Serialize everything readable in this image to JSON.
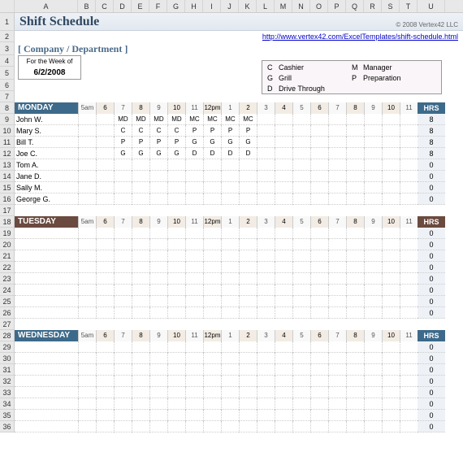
{
  "title": "Shift Schedule",
  "copyright": "© 2008 Vertex42 LLC",
  "link_text": "http://www.vertex42.com/ExcelTemplates/shift-schedule.html",
  "company_label": "[ Company / Department ]",
  "week_label": "For the Week of",
  "week_date": "6/2/2008",
  "legend": [
    {
      "code": "C",
      "name": "Cashier"
    },
    {
      "code": "G",
      "name": "Grill"
    },
    {
      "code": "D",
      "name": "Drive Through"
    },
    {
      "code": "M",
      "name": "Manager"
    },
    {
      "code": "P",
      "name": "Preparation"
    }
  ],
  "col_letters": [
    "A",
    "B",
    "C",
    "D",
    "E",
    "F",
    "G",
    "H",
    "I",
    "J",
    "K",
    "L",
    "M",
    "N",
    "O",
    "P",
    "Q",
    "R",
    "S",
    "T",
    "U"
  ],
  "row_numbers_visible": [
    1,
    2,
    3,
    4,
    5,
    6,
    7,
    8,
    9,
    10,
    11,
    12,
    13,
    14,
    15,
    16,
    17,
    18,
    19,
    20,
    21,
    22,
    23,
    24,
    25,
    26,
    27,
    28,
    29,
    30,
    31,
    32,
    33,
    34,
    35,
    36
  ],
  "time_headers": [
    "5am",
    "6",
    "7",
    "8",
    "9",
    "10",
    "11",
    "12pm",
    "1",
    "2",
    "3",
    "4",
    "5",
    "6",
    "7",
    "8",
    "9",
    "10",
    "11"
  ],
  "hrs_label": "HRS",
  "days": [
    {
      "name": "MONDAY",
      "class": "monday",
      "rows": [
        {
          "name": "John W.",
          "slots": [
            "",
            "",
            "MD",
            "MD",
            "MD",
            "MD",
            "MC",
            "MC",
            "MC",
            "MC",
            "",
            "",
            "",
            "",
            "",
            "",
            "",
            "",
            ""
          ],
          "hrs": "8"
        },
        {
          "name": "Mary S.",
          "slots": [
            "",
            "",
            "C",
            "C",
            "C",
            "C",
            "P",
            "P",
            "P",
            "P",
            "",
            "",
            "",
            "",
            "",
            "",
            "",
            "",
            ""
          ],
          "hrs": "8"
        },
        {
          "name": "Bill T.",
          "slots": [
            "",
            "",
            "P",
            "P",
            "P",
            "P",
            "G",
            "G",
            "G",
            "G",
            "",
            "",
            "",
            "",
            "",
            "",
            "",
            "",
            ""
          ],
          "hrs": "8"
        },
        {
          "name": "Joe C.",
          "slots": [
            "",
            "",
            "G",
            "G",
            "G",
            "G",
            "D",
            "D",
            "D",
            "D",
            "",
            "",
            "",
            "",
            "",
            "",
            "",
            "",
            ""
          ],
          "hrs": "8"
        },
        {
          "name": "Tom A.",
          "slots": [
            "",
            "",
            "",
            "",
            "",
            "",
            "",
            "",
            "",
            "",
            "",
            "",
            "",
            "",
            "",
            "",
            "",
            "",
            ""
          ],
          "hrs": "0"
        },
        {
          "name": "Jane D.",
          "slots": [
            "",
            "",
            "",
            "",
            "",
            "",
            "",
            "",
            "",
            "",
            "",
            "",
            "",
            "",
            "",
            "",
            "",
            "",
            ""
          ],
          "hrs": "0"
        },
        {
          "name": "Sally M.",
          "slots": [
            "",
            "",
            "",
            "",
            "",
            "",
            "",
            "",
            "",
            "",
            "",
            "",
            "",
            "",
            "",
            "",
            "",
            "",
            ""
          ],
          "hrs": "0"
        },
        {
          "name": "George G.",
          "slots": [
            "",
            "",
            "",
            "",
            "",
            "",
            "",
            "",
            "",
            "",
            "",
            "",
            "",
            "",
            "",
            "",
            "",
            "",
            ""
          ],
          "hrs": "0"
        }
      ]
    },
    {
      "name": "TUESDAY",
      "class": "tuesday",
      "rows": [
        {
          "name": "",
          "slots": [
            "",
            "",
            "",
            "",
            "",
            "",
            "",
            "",
            "",
            "",
            "",
            "",
            "",
            "",
            "",
            "",
            "",
            "",
            ""
          ],
          "hrs": "0"
        },
        {
          "name": "",
          "slots": [
            "",
            "",
            "",
            "",
            "",
            "",
            "",
            "",
            "",
            "",
            "",
            "",
            "",
            "",
            "",
            "",
            "",
            "",
            ""
          ],
          "hrs": "0"
        },
        {
          "name": "",
          "slots": [
            "",
            "",
            "",
            "",
            "",
            "",
            "",
            "",
            "",
            "",
            "",
            "",
            "",
            "",
            "",
            "",
            "",
            "",
            ""
          ],
          "hrs": "0"
        },
        {
          "name": "",
          "slots": [
            "",
            "",
            "",
            "",
            "",
            "",
            "",
            "",
            "",
            "",
            "",
            "",
            "",
            "",
            "",
            "",
            "",
            "",
            ""
          ],
          "hrs": "0"
        },
        {
          "name": "",
          "slots": [
            "",
            "",
            "",
            "",
            "",
            "",
            "",
            "",
            "",
            "",
            "",
            "",
            "",
            "",
            "",
            "",
            "",
            "",
            ""
          ],
          "hrs": "0"
        },
        {
          "name": "",
          "slots": [
            "",
            "",
            "",
            "",
            "",
            "",
            "",
            "",
            "",
            "",
            "",
            "",
            "",
            "",
            "",
            "",
            "",
            "",
            ""
          ],
          "hrs": "0"
        },
        {
          "name": "",
          "slots": [
            "",
            "",
            "",
            "",
            "",
            "",
            "",
            "",
            "",
            "",
            "",
            "",
            "",
            "",
            "",
            "",
            "",
            "",
            ""
          ],
          "hrs": "0"
        },
        {
          "name": "",
          "slots": [
            "",
            "",
            "",
            "",
            "",
            "",
            "",
            "",
            "",
            "",
            "",
            "",
            "",
            "",
            "",
            "",
            "",
            "",
            ""
          ],
          "hrs": "0"
        }
      ]
    },
    {
      "name": "WEDNESDAY",
      "class": "wednesday",
      "rows": [
        {
          "name": "",
          "slots": [
            "",
            "",
            "",
            "",
            "",
            "",
            "",
            "",
            "",
            "",
            "",
            "",
            "",
            "",
            "",
            "",
            "",
            "",
            ""
          ],
          "hrs": "0"
        },
        {
          "name": "",
          "slots": [
            "",
            "",
            "",
            "",
            "",
            "",
            "",
            "",
            "",
            "",
            "",
            "",
            "",
            "",
            "",
            "",
            "",
            "",
            ""
          ],
          "hrs": "0"
        },
        {
          "name": "",
          "slots": [
            "",
            "",
            "",
            "",
            "",
            "",
            "",
            "",
            "",
            "",
            "",
            "",
            "",
            "",
            "",
            "",
            "",
            "",
            ""
          ],
          "hrs": "0"
        },
        {
          "name": "",
          "slots": [
            "",
            "",
            "",
            "",
            "",
            "",
            "",
            "",
            "",
            "",
            "",
            "",
            "",
            "",
            "",
            "",
            "",
            "",
            ""
          ],
          "hrs": "0"
        },
        {
          "name": "",
          "slots": [
            "",
            "",
            "",
            "",
            "",
            "",
            "",
            "",
            "",
            "",
            "",
            "",
            "",
            "",
            "",
            "",
            "",
            "",
            ""
          ],
          "hrs": "0"
        },
        {
          "name": "",
          "slots": [
            "",
            "",
            "",
            "",
            "",
            "",
            "",
            "",
            "",
            "",
            "",
            "",
            "",
            "",
            "",
            "",
            "",
            "",
            ""
          ],
          "hrs": "0"
        },
        {
          "name": "",
          "slots": [
            "",
            "",
            "",
            "",
            "",
            "",
            "",
            "",
            "",
            "",
            "",
            "",
            "",
            "",
            "",
            "",
            "",
            "",
            ""
          ],
          "hrs": "0"
        },
        {
          "name": "",
          "slots": [
            "",
            "",
            "",
            "",
            "",
            "",
            "",
            "",
            "",
            "",
            "",
            "",
            "",
            "",
            "",
            "",
            "",
            "",
            ""
          ],
          "hrs": "0"
        }
      ]
    }
  ]
}
